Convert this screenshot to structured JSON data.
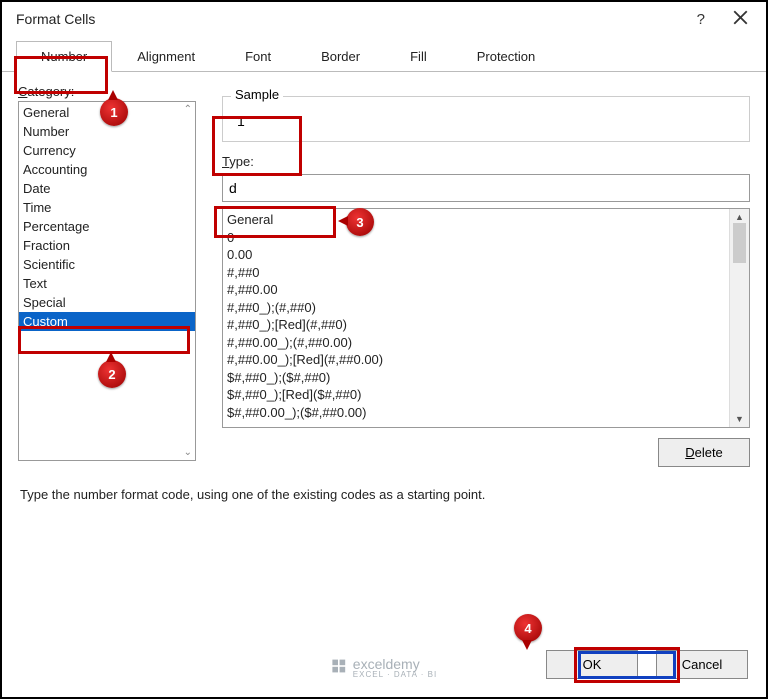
{
  "window": {
    "title": "Format Cells"
  },
  "tabs": {
    "items": [
      "Number",
      "Alignment",
      "Font",
      "Border",
      "Fill",
      "Protection"
    ],
    "active": 0
  },
  "left": {
    "label_html": "Category:",
    "label_underline_char": "C",
    "items": [
      "General",
      "Number",
      "Currency",
      "Accounting",
      "Date",
      "Time",
      "Percentage",
      "Fraction",
      "Scientific",
      "Text",
      "Special",
      "Custom"
    ],
    "selected_index": 11
  },
  "right": {
    "sample_label": "Sample",
    "sample_value": "1",
    "type_label_html": "Type:",
    "type_underline_char": "T",
    "type_value": "d",
    "type_list": [
      "General",
      "0",
      "0.00",
      "#,##0",
      "#,##0.00",
      "#,##0_);(#,##0)",
      "#,##0_);[Red](#,##0)",
      "#,##0.00_);(#,##0.00)",
      "#,##0.00_);[Red](#,##0.00)",
      "$#,##0_);($#,##0)",
      "$#,##0_);[Red]($#,##0)",
      "$#,##0.00_);($#,##0.00)"
    ],
    "delete_label": "Delete",
    "delete_underline_char": "D"
  },
  "hint": "Type the number format code, using one of the existing codes as a starting point.",
  "buttons": {
    "ok": "OK",
    "cancel": "Cancel"
  },
  "watermark": {
    "brand": "exceldemy",
    "sub": "EXCEL · DATA · BI"
  },
  "callouts": {
    "c1": "1",
    "c2": "2",
    "c3": "3",
    "c4": "4"
  }
}
